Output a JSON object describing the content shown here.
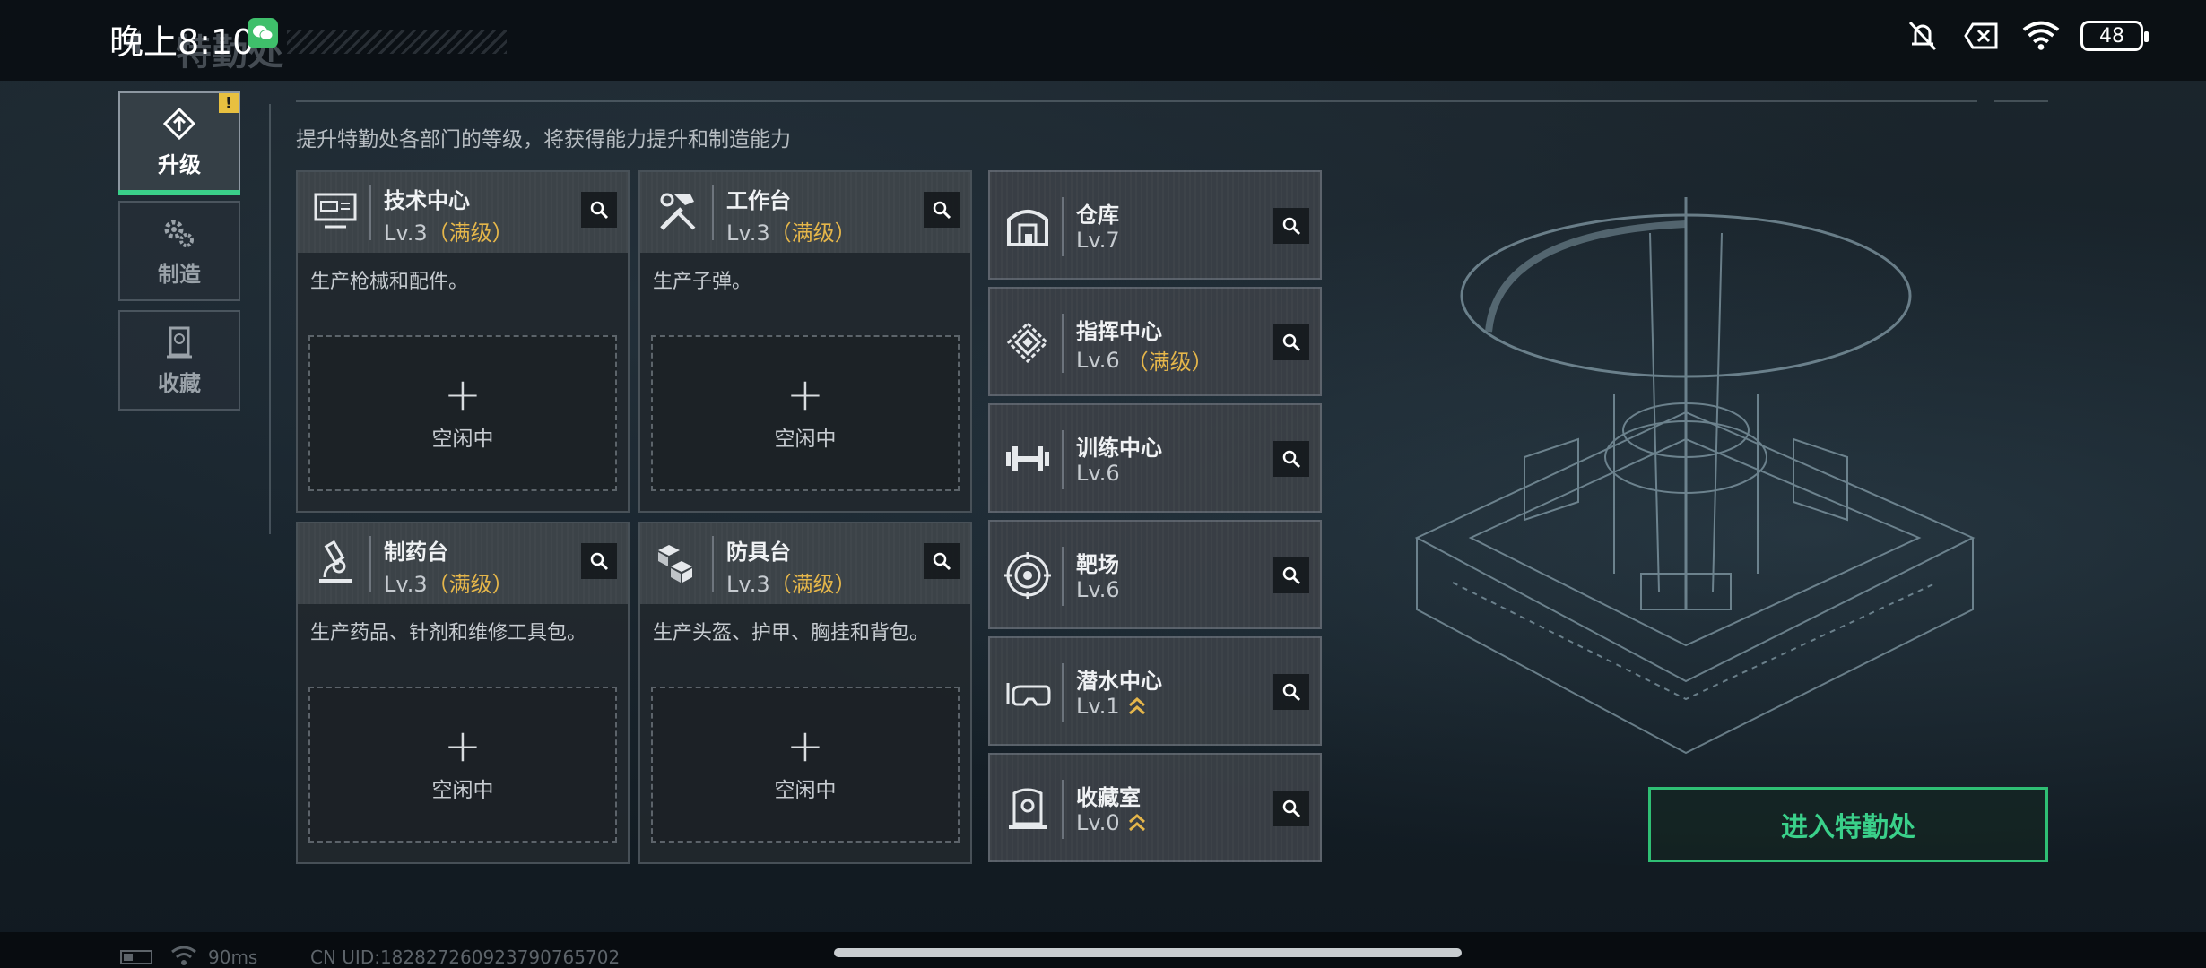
{
  "status_bar": {
    "time": "晚上8:10",
    "battery": "48"
  },
  "header": {
    "title": "特勤处"
  },
  "tabs": [
    {
      "label": "升级",
      "icon": "upgrade-icon",
      "active": true
    },
    {
      "label": "制造",
      "icon": "gears-icon",
      "active": false
    },
    {
      "label": "收藏",
      "icon": "collection-icon",
      "active": false
    }
  ],
  "subtitle": "提升特勤处各部门的等级，将获得能力提升和制造能力",
  "workshops": [
    {
      "name": "技术中心",
      "level": "Lv.3",
      "max_tag": "（满级）",
      "desc": "生产枪械和配件。",
      "slot_plus": "+",
      "slot_label": "空闲中",
      "icon": "computer-icon"
    },
    {
      "name": "工作台",
      "level": "Lv.3",
      "max_tag": "（满级）",
      "desc": "生产子弹。",
      "slot_plus": "+",
      "slot_label": "空闲中",
      "icon": "tools-icon"
    },
    {
      "name": "制药台",
      "level": "Lv.3",
      "max_tag": "（满级）",
      "desc": "生产药品、针剂和维修工具包。",
      "slot_plus": "+",
      "slot_label": "空闲中",
      "icon": "microscope-icon"
    },
    {
      "name": "防具台",
      "level": "Lv.3",
      "max_tag": "（满级）",
      "desc": "生产头盔、护甲、胸挂和背包。",
      "slot_plus": "+",
      "slot_label": "空闲中",
      "icon": "armor-boxes-icon"
    }
  ],
  "facilities": [
    {
      "name": "仓库",
      "level": "Lv.7",
      "max_tag": "",
      "upgradable": false,
      "icon": "warehouse-icon"
    },
    {
      "name": "指挥中心",
      "level": "Lv.6",
      "max_tag": "（满级）",
      "upgradable": false,
      "icon": "chip-icon"
    },
    {
      "name": "训练中心",
      "level": "Lv.6",
      "max_tag": "",
      "upgradable": false,
      "icon": "dumbbell-icon"
    },
    {
      "name": "靶场",
      "level": "Lv.6",
      "max_tag": "",
      "upgradable": false,
      "icon": "target-icon"
    },
    {
      "name": "潜水中心",
      "level": "Lv.1",
      "max_tag": "",
      "upgradable": true,
      "icon": "diving-mask-icon"
    },
    {
      "name": "收藏室",
      "level": "Lv.0",
      "max_tag": "",
      "upgradable": true,
      "icon": "display-case-icon"
    }
  ],
  "enter_button": "进入特勤处",
  "footer": {
    "ping": "90ms",
    "uid": "CN UID:18282726092379076570​2"
  },
  "colors": {
    "accent_green": "#3ad08a",
    "max_level_gold": "#e5b64a",
    "upgrade_arrow": "#e5b64a"
  }
}
